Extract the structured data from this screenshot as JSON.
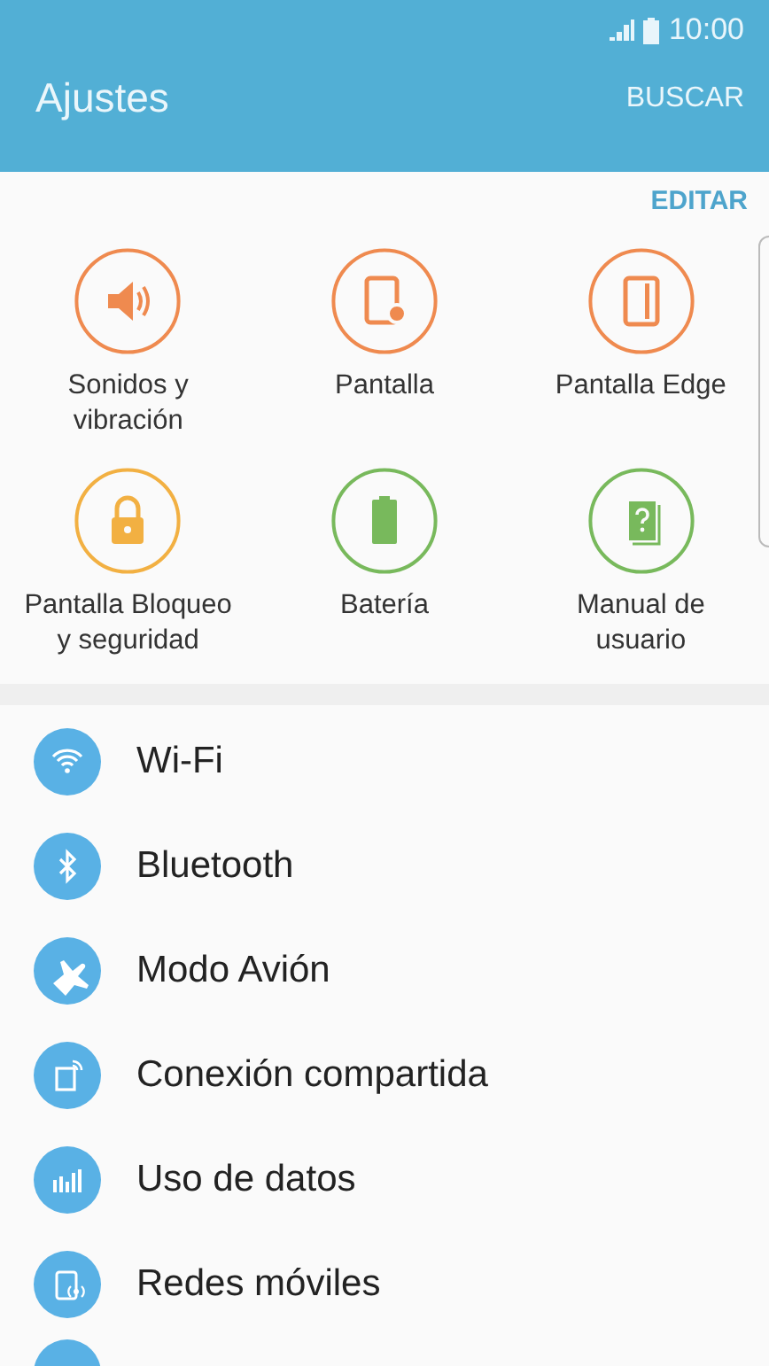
{
  "status_bar": {
    "time": "10:00"
  },
  "app_bar": {
    "title": "Ajustes",
    "action": "BUSCAR"
  },
  "quick_settings": {
    "edit": "EDITAR",
    "tiles": [
      {
        "label": "Sonidos y vibración",
        "color": "#ef8a4f"
      },
      {
        "label": "Pantalla",
        "color": "#ef8a4f"
      },
      {
        "label": "Pantalla Edge",
        "color": "#ef8a4f"
      },
      {
        "label": "Pantalla Bloqueo y seguridad",
        "color": "#f2b042"
      },
      {
        "label": "Batería",
        "color": "#78b95c"
      },
      {
        "label": "Manual de usuario",
        "color": "#78b95c"
      }
    ]
  },
  "settings": [
    {
      "label": "Wi-Fi"
    },
    {
      "label": "Bluetooth"
    },
    {
      "label": "Modo Avión"
    },
    {
      "label": "Conexión compartida"
    },
    {
      "label": "Uso de datos"
    },
    {
      "label": "Redes móviles"
    }
  ]
}
